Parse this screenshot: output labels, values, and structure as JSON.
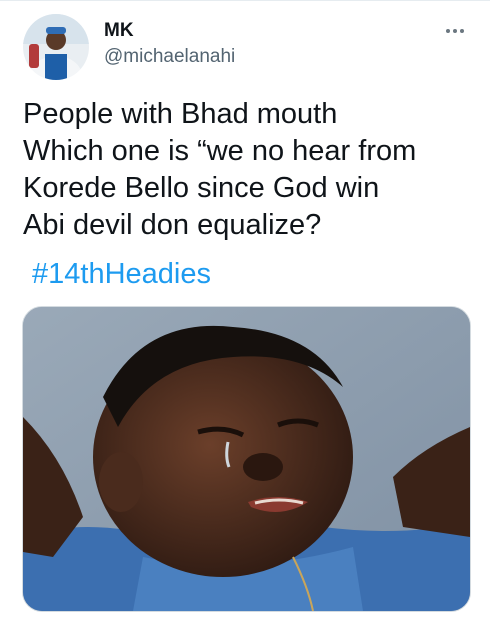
{
  "tweet": {
    "author": {
      "display_name": "MK",
      "handle": "@michaelanahi",
      "avatar_icon": "profile-photo"
    },
    "more_icon": "more-horizontal-icon",
    "text_lines": [
      "People with Bhad mouth",
      "Which one is “we no hear from",
      "Korede Bello since God win",
      "Abi devil don equalize?"
    ],
    "hashtag": "#14thHeadies",
    "media": {
      "type": "photo",
      "description_icon": "crying-meme-photo"
    }
  },
  "colors": {
    "text": "#0f1419",
    "secondary": "#536471",
    "link": "#1d9bf0",
    "background": "#ffffff"
  }
}
